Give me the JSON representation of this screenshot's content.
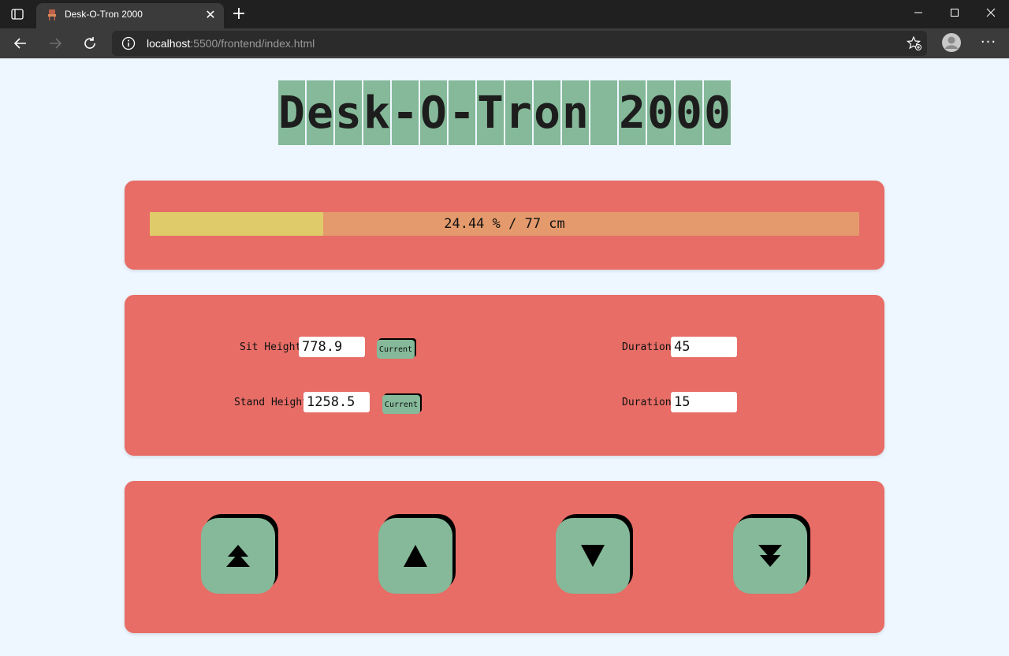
{
  "browser": {
    "tab_title": "Desk-O-Tron 2000",
    "url_host": "localhost",
    "url_rest": ":5500/frontend/index.html"
  },
  "app": {
    "title_chars": [
      "D",
      "e",
      "s",
      "k",
      "-",
      "O",
      "-",
      "T",
      "r",
      "o",
      "n",
      " ",
      "2",
      "0",
      "0",
      "0"
    ],
    "progress": {
      "fraction": 0.2444,
      "label": "24.44 % / 77 cm",
      "fill_color": "#e0cb6a",
      "track_color": "#e49a6c"
    },
    "settings": {
      "sit_label": "Sit Height",
      "sit_value": "778.9",
      "sit_current": "Current",
      "stand_label": "Stand Height",
      "stand_value": "1258.5",
      "stand_current": "Current",
      "sit_duration_label": "Duration",
      "sit_duration_value": "45",
      "stand_duration_label": "Duration",
      "stand_duration_value": "15"
    },
    "controls": [
      "double-up-icon",
      "up-icon",
      "down-icon",
      "double-down-icon"
    ],
    "colors": {
      "panel": "#e76d66",
      "accent": "#85b999",
      "background": "#eef6ff"
    }
  }
}
